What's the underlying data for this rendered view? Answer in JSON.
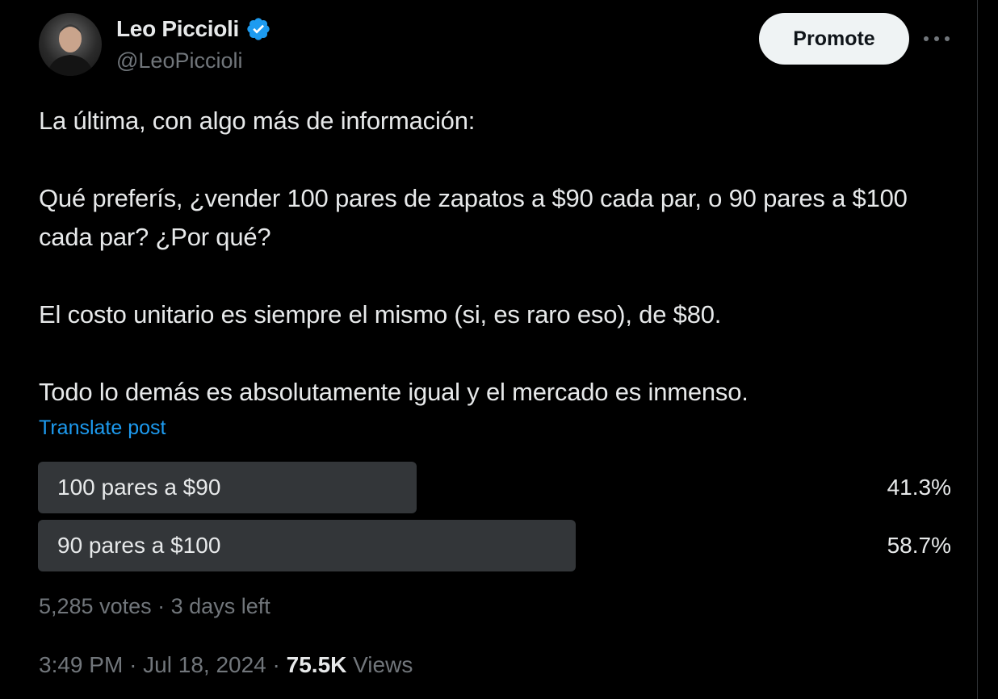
{
  "author": {
    "display_name": "Leo Piccioli",
    "handle": "@LeoPiccioli",
    "verified": true,
    "verified_icon": "verified-badge-icon"
  },
  "actions": {
    "promote_label": "Promote",
    "more_icon": "more-dots-icon"
  },
  "post": {
    "lines": [
      "La última, con algo más de información:",
      "Qué preferís, ¿vender 100 pares de zapatos a $90 cada par, o 90 pares a $100 cada par?  ¿Por qué?",
      "El costo unitario es siempre el mismo (si, es raro eso), de $80.",
      "Todo lo demás es absolutamente igual y el mercado es inmenso."
    ],
    "translate_label": "Translate post"
  },
  "poll": {
    "options": [
      {
        "label": "100 pares a $90",
        "percent_label": "41.3%",
        "percent": 41.3
      },
      {
        "label": "90 pares a $100",
        "percent_label": "58.7%",
        "percent": 58.7
      }
    ],
    "votes": "5,285 votes",
    "separator": "·",
    "time_left": "3 days left"
  },
  "meta": {
    "time": "3:49 PM",
    "separator": "·",
    "date": "Jul 18, 2024",
    "views_count": "75.5K",
    "views_label": "Views"
  },
  "colors": {
    "background": "#000000",
    "text": "#e7e9ea",
    "muted": "#71767b",
    "link": "#1d9bf0",
    "poll_fill": "#333639",
    "verified": "#1d9bf0"
  }
}
